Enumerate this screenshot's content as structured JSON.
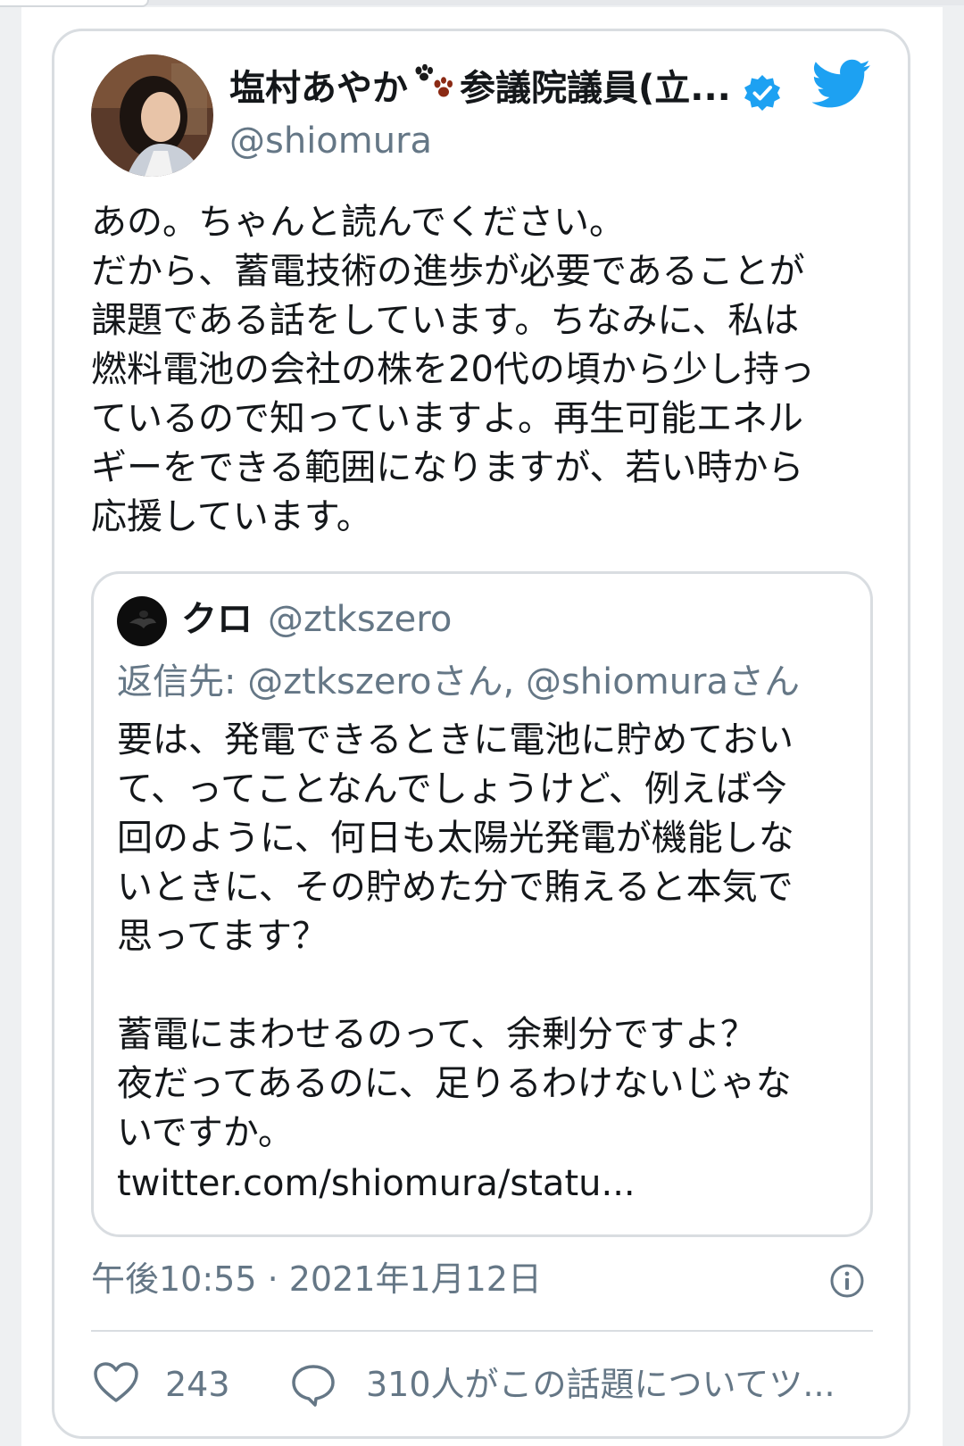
{
  "tweet": {
    "author_name": "塩村あやか",
    "author_name_suffix": "参議院議員(立...",
    "author_handle": "@shiomura",
    "text_lines": [
      "あの。ちゃんと読んでください。",
      "だから、蓄電技術の進歩が必要であることが",
      "課題である話をしています。ちなみに、私は",
      "燃料電池の会社の株を20代の頃から少し持っ",
      "ているので知っていますよ。再生可能エネル",
      "ギーをできる範囲になりますが、若い時から",
      "応援しています。"
    ],
    "timestamp": "午後10:55 · 2021年1月12日",
    "like_count": "243",
    "conversation_text": "310人がこの話題についてツ..."
  },
  "quoted_tweet": {
    "author_name": "クロ",
    "author_handle": "@ztkszero",
    "reply_to": "返信先: @ztkszeroさん, @shiomuraさん",
    "text_lines": [
      "要は、発電できるときに電池に貯めておい",
      "て、ってことなんでしょうけど、例えば今",
      "回のように、何日も太陽光発電が機能しな",
      "いときに、その貯めた分で賄えると本気で",
      "思ってます？",
      "",
      "蓄電にまわせるのって、余剰分ですよ？",
      "夜だってあるのに、足りるわけないじゃな",
      "いですか。"
    ],
    "link": "twitter.com/shiomura/statu..."
  },
  "icons": {
    "paw": "paw-prints-icon",
    "verified": "verified-badge-icon",
    "twitter": "twitter-bird-icon",
    "info": "info-icon",
    "like": "heart-icon",
    "reply": "speech-bubble-icon"
  },
  "colors": {
    "twitter_blue": "#1da1f2",
    "text": "#14171a",
    "secondary_text": "#657786",
    "border": "#d9dde1"
  }
}
